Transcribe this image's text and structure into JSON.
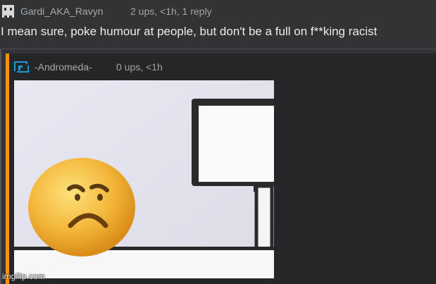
{
  "top_comment": {
    "author": "Gardi_AKA_Ravyn",
    "stats": "2 ups, <1h, 1 reply",
    "text": "I mean sure, poke humour at people, but don't be a full on f**king racist",
    "avatar_icon": "pixel-face-avatar-icon"
  },
  "reply": {
    "author": "-Andromeda-",
    "stats": "0 ups, <1h",
    "avatar_icon": "blue-square-logo-avatar-icon",
    "accent_color": "#f7930f"
  },
  "watermark": "imgflip.com"
}
